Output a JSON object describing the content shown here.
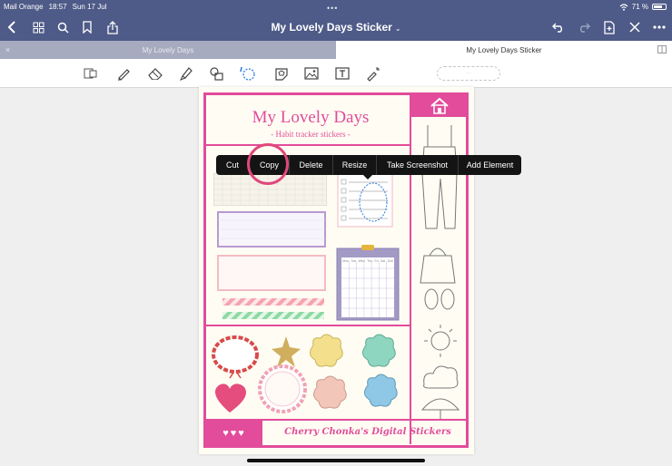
{
  "status": {
    "carrier": "Mail Orange",
    "time": "18:57",
    "date": "Sun 17 Jul",
    "battery": "71 %"
  },
  "header": {
    "title": "My Lovely Days Sticker"
  },
  "tabs": [
    {
      "label": "My Lovely Days"
    },
    {
      "label": "My Lovely Days Sticker"
    }
  ],
  "context_menu": {
    "items": [
      "Cut",
      "Copy",
      "Delete",
      "Resize",
      "Take Screenshot",
      "Add Element"
    ]
  },
  "sticker_page": {
    "title": "My Lovely Days",
    "subtitle": "- Habit tracker stickers -",
    "footer": "Cherry Chonka's Digital Stickers",
    "hearts": "♥♥♥",
    "calendar_days": [
      "Mon",
      "Tue",
      "Wed",
      "Thu",
      "Fri",
      "Sat",
      "Sun"
    ]
  },
  "colors": {
    "topbar": "#4e5a87",
    "accent_pink": "#e24c9b",
    "menu_bg": "#141414"
  }
}
